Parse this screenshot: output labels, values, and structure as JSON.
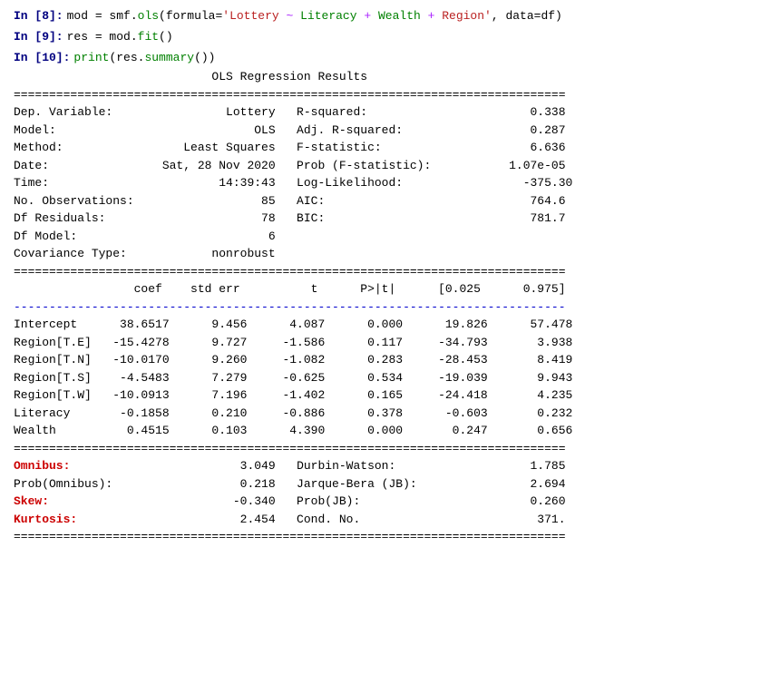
{
  "cells": [
    {
      "id": "cell-8",
      "label": "In [8]:",
      "code_parts": [
        {
          "text": "mod",
          "class": "kw-var"
        },
        {
          "text": " = ",
          "class": "code-equal"
        },
        {
          "text": "smf",
          "class": "kw-var"
        },
        {
          "text": ".",
          "class": "kw-var"
        },
        {
          "text": "ols",
          "class": "code-keyword"
        },
        {
          "text": "(",
          "class": "code-paren"
        },
        {
          "text": "formula=",
          "class": "kw-var"
        },
        {
          "text": "'Lottery ~ Literacy + Wealth + Region'",
          "class": "code-string"
        },
        {
          "text": ", ",
          "class": "kw-var"
        },
        {
          "text": "data=df",
          "class": "kw-var"
        },
        {
          "text": ")",
          "class": "code-paren"
        }
      ]
    },
    {
      "id": "cell-9",
      "label": "In [9]:",
      "code_parts": [
        {
          "text": "res",
          "class": "kw-var"
        },
        {
          "text": " = ",
          "class": "code-equal"
        },
        {
          "text": "mod",
          "class": "kw-var"
        },
        {
          "text": ".",
          "class": "kw-var"
        },
        {
          "text": "fit",
          "class": "code-keyword"
        },
        {
          "text": "()",
          "class": "code-paren"
        }
      ]
    },
    {
      "id": "cell-10",
      "label": "In [10]:",
      "code_parts": [
        {
          "text": "print",
          "class": "code-keyword"
        },
        {
          "text": "(",
          "class": "code-paren"
        },
        {
          "text": "res",
          "class": "kw-var"
        },
        {
          "text": ".",
          "class": "kw-var"
        },
        {
          "text": "summary",
          "class": "code-keyword"
        },
        {
          "text": "())",
          "class": "code-paren"
        }
      ]
    }
  ],
  "output": {
    "title": "                            OLS Regression Results                            ",
    "eq_line": "==============================================================================",
    "rows_top": [
      [
        "Dep. Variable:",
        "                Lottery",
        "R-squared:",
        "                 0.338"
      ],
      [
        "Model:",
        "                    OLS",
        "Adj. R-squared:",
        "                 0.287"
      ],
      [
        "Method:",
        "          Least Squares",
        "F-statistic:",
        "                 6.636"
      ],
      [
        "Date:",
        "       Sat, 28 Nov 2020",
        "Prob (F-statistic):",
        "              1.07e-05"
      ],
      [
        "Time:",
        "               14:39:43",
        "Log-Likelihood:",
        "                -375.30"
      ],
      [
        "No. Observations:",
        "                     85",
        "AIC:",
        "                  764.6"
      ],
      [
        "Df Residuals:",
        "                     78",
        "BIC:",
        "                  781.7"
      ],
      [
        "Df Model:",
        "                      6",
        "",
        ""
      ],
      [
        "Covariance Type:",
        "           nonrobust",
        "",
        ""
      ]
    ],
    "dash_line": "==============================================================================",
    "col_headers": "                 coef    std err          t      P>|t|      [0.025      0.975]",
    "inner_dash": "------------------------------------------------------------------------------",
    "data_rows": [
      [
        "Intercept    ",
        "  38.6517  ",
        "  9.456  ",
        "  4.087  ",
        "  0.000  ",
        "  19.826  ",
        "  57.478"
      ],
      [
        "Region[T.E]  ",
        " -15.4278  ",
        "  9.727  ",
        " -1.586  ",
        "  0.117  ",
        " -34.793  ",
        "   3.938"
      ],
      [
        "Region[T.N]  ",
        " -10.0170  ",
        "  9.260  ",
        " -1.082  ",
        "  0.283  ",
        " -28.453  ",
        "   8.419"
      ],
      [
        "Region[T.S]  ",
        "  -4.5483  ",
        "  7.279  ",
        " -0.625  ",
        "  0.534  ",
        " -19.039  ",
        "   9.943"
      ],
      [
        "Region[T.W]  ",
        " -10.0913  ",
        "  7.196  ",
        " -1.402  ",
        "  0.165  ",
        " -24.418  ",
        "   4.235"
      ],
      [
        "Literacy     ",
        "  -0.1858  ",
        "  0.210  ",
        " -0.886  ",
        "  0.378  ",
        "  -0.603  ",
        "   0.232"
      ],
      [
        "Wealth       ",
        "   0.4515  ",
        "  0.103  ",
        "  4.390  ",
        "  0.000  ",
        "   0.247  ",
        "   0.656"
      ]
    ],
    "bottom_eq": "==============================================================================",
    "stats_rows": [
      {
        "label": "Omnibus:",
        "label_red": true,
        "value1": "         3.049",
        "label2": "Durbin-Watson:",
        "label2_red": false,
        "value2": "             1.785"
      },
      {
        "label": "Prob(Omnibus):",
        "label_red": false,
        "value1": "         0.218",
        "label2": "Jarque-Bera (JB):",
        "label2_red": false,
        "value2": "             2.694"
      },
      {
        "label": "Skew:",
        "label_red": true,
        "value1": "        -0.340",
        "label2": "Prob(JB):",
        "label2_red": false,
        "value2": "             0.260"
      },
      {
        "label": "Kurtosis:",
        "label_red": true,
        "value1": "         2.454",
        "label2": "Cond. No.",
        "label2_red": false,
        "value2": "              371."
      }
    ],
    "final_eq": "=============================================================================="
  }
}
